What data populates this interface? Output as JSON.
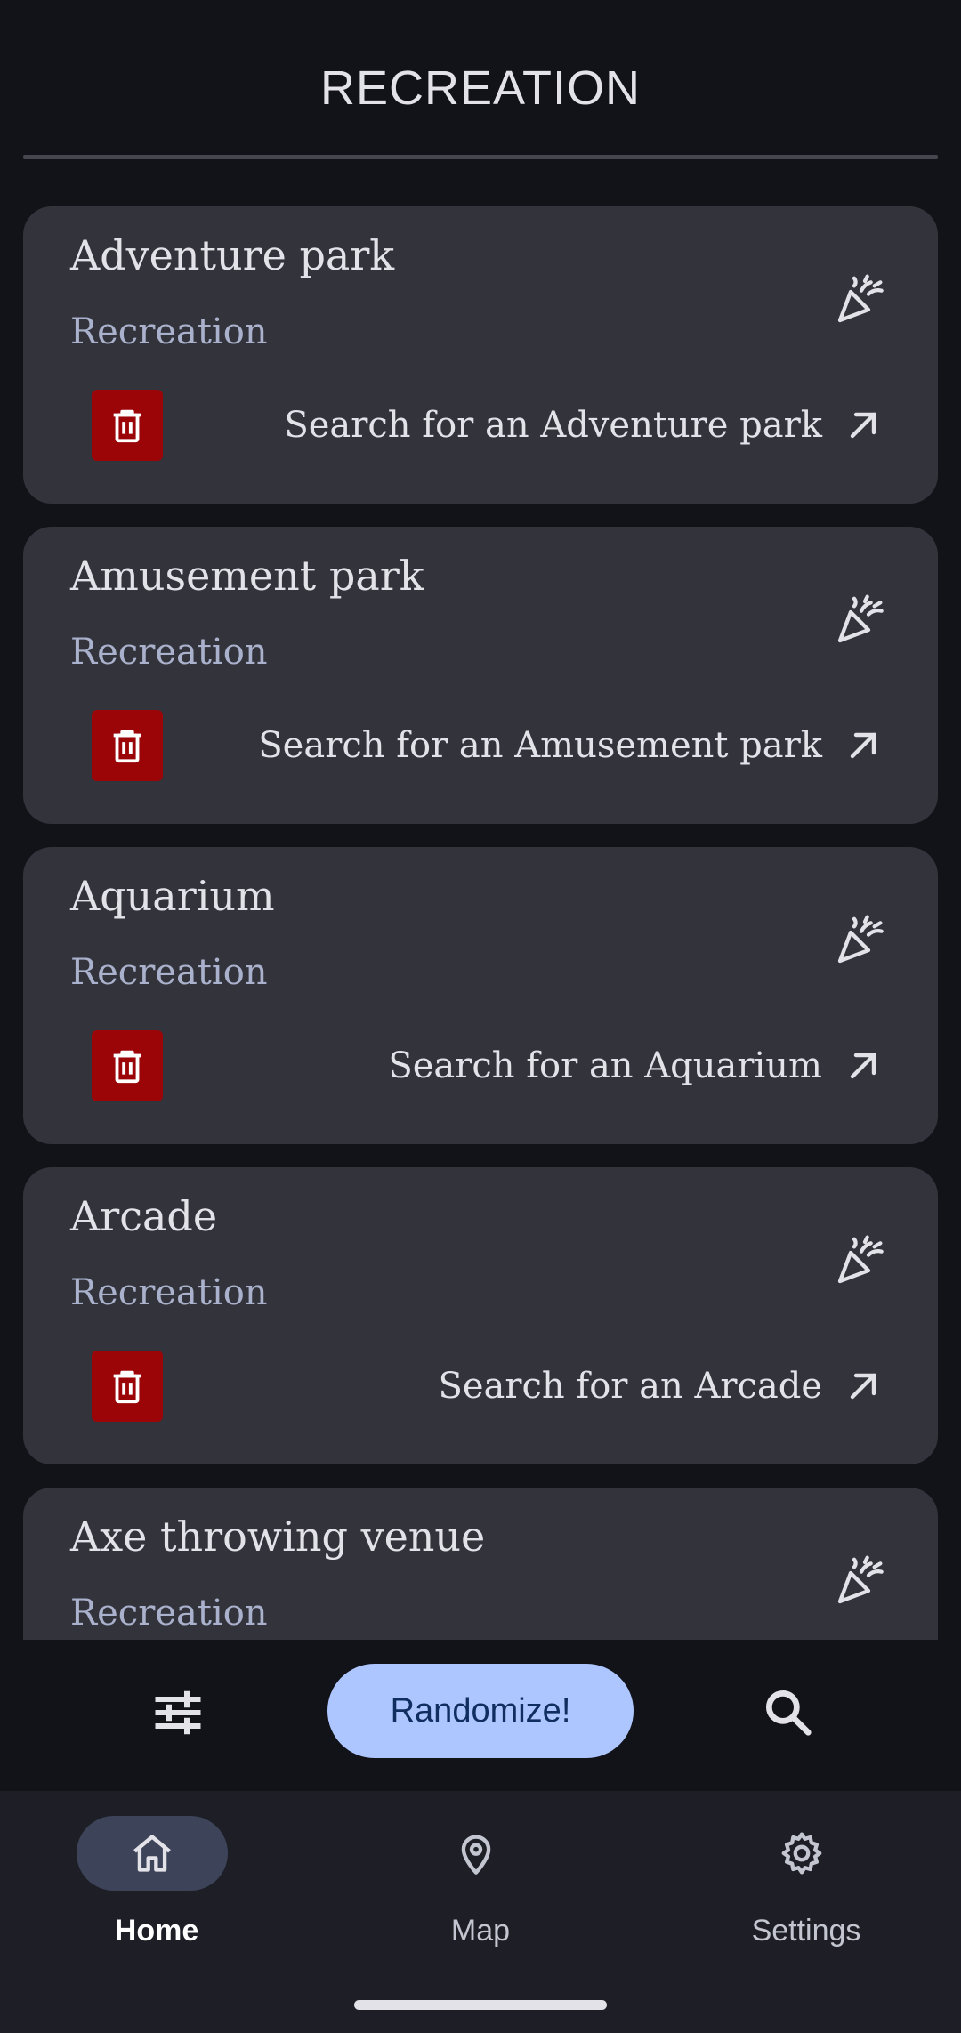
{
  "header": {
    "title": "RECREATION"
  },
  "cards": [
    {
      "name": "Adventure park",
      "category": "Recreation",
      "search_label": "Search for an Adventure park"
    },
    {
      "name": "Amusement park",
      "category": "Recreation",
      "search_label": "Search for an Amusement park"
    },
    {
      "name": "Aquarium",
      "category": "Recreation",
      "search_label": "Search for an Aquarium"
    },
    {
      "name": "Arcade",
      "category": "Recreation",
      "search_label": "Search for an Arcade"
    },
    {
      "name": "Axe throwing venue",
      "category": "Recreation"
    }
  ],
  "actions": {
    "randomize_label": "Randomize!"
  },
  "nav": {
    "items": [
      {
        "label": "Home",
        "icon": "home-icon",
        "active": true
      },
      {
        "label": "Map",
        "icon": "map-pin-icon",
        "active": false
      },
      {
        "label": "Settings",
        "icon": "gear-icon",
        "active": false
      }
    ]
  },
  "colors": {
    "background": "#121318",
    "card": "#33343b",
    "accent": "#aec6ff",
    "delete": "#9b0508",
    "nav_active": "#3d4459"
  }
}
